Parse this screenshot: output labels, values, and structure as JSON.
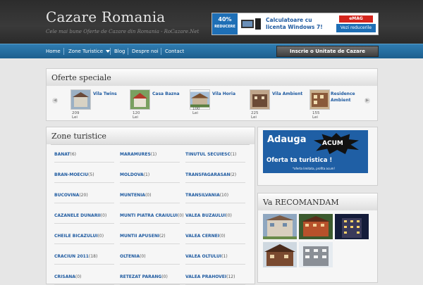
{
  "header": {
    "title": "Cazare Romania",
    "tagline": "Cele mai bune Oferte de Cazare din Romania - RoCazare.Net"
  },
  "banner": {
    "discount_value": "40%",
    "discount_label": "REDUCERE",
    "text": "Calculatoare cu licenta Windows 7!",
    "logo": "eMAG",
    "cta": "Vezi reducerile"
  },
  "nav": {
    "items": [
      "Home",
      "Zone Turistice",
      "Blog",
      "Despre noi",
      "Contact"
    ],
    "signup": "Inscrie o Unitate de Cazare"
  },
  "offers": {
    "title": "Oferte speciale",
    "items": [
      {
        "name": "Vila Twins",
        "price": "209 Lei"
      },
      {
        "name": "Casa Bazna",
        "price": "120 Lei"
      },
      {
        "name": "Vila Horia",
        "price": "100 Lei"
      },
      {
        "name": "Vila Ambient",
        "price": "225 Lei"
      },
      {
        "name": "Residence Ambient",
        "price": "155 Lei"
      }
    ]
  },
  "zones": {
    "title": "Zone turistice",
    "items": [
      {
        "name": "BANAT",
        "count": "(6)"
      },
      {
        "name": "MARAMURES",
        "count": "(1)"
      },
      {
        "name": "TINUTUL SECUIESC",
        "count": "(1)"
      },
      {
        "name": "BRAN-MOECIU",
        "count": "(5)"
      },
      {
        "name": "MOLDOVA",
        "count": "(1)"
      },
      {
        "name": "TRANSFAGARASAN",
        "count": "(2)"
      },
      {
        "name": "BUCOVINA",
        "count": "(20)"
      },
      {
        "name": "MUNTENIA",
        "count": "(0)"
      },
      {
        "name": "TRANSILVANIA",
        "count": "(10)"
      },
      {
        "name": "CAZANELE DUNARII",
        "count": "(0)"
      },
      {
        "name": "MUNTI PIATRA CRAIULUI",
        "count": "(0)"
      },
      {
        "name": "VALEA BUZAULUI",
        "count": "(0)"
      },
      {
        "name": "CHEILE BICAZULUI",
        "count": "(0)"
      },
      {
        "name": "MUNTII APUSENI",
        "count": "(2)"
      },
      {
        "name": "VALEA CERNEI",
        "count": "(0)"
      },
      {
        "name": "CRACIUN 2011",
        "count": "(18)"
      },
      {
        "name": "OLTENIA",
        "count": "(0)"
      },
      {
        "name": "VALEA OLTULUI",
        "count": "(1)"
      },
      {
        "name": "CRISANA",
        "count": "(0)"
      },
      {
        "name": "RETEZAT PARANG",
        "count": "(0)"
      },
      {
        "name": "VALEA PRAHOVEI",
        "count": "(12)"
      }
    ]
  },
  "ad": {
    "line1": "Adauga",
    "line1b": "ACUM",
    "line2": "Oferta ta turistica !",
    "line3": "*oferta limitata, profita acum!"
  },
  "recommend": {
    "title": "Va RECOMANDAM"
  }
}
